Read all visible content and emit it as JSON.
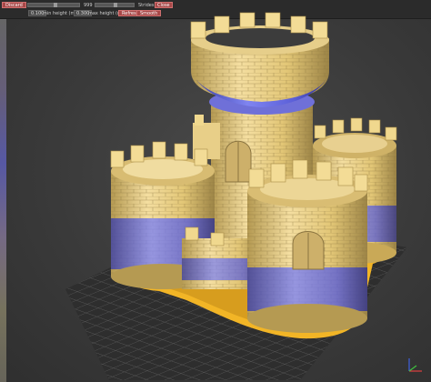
{
  "toolbar": {
    "discard_label": "Discard",
    "center_value": "999",
    "strides_label": "Strides",
    "close_label": "Close",
    "min_height_value": "0.100",
    "min_height_label": "min height (mm)",
    "max_height_value": "0.300",
    "max_height_label": "max height (mm)",
    "refresh_label": "Refresh",
    "smooth_label": "Smooth"
  },
  "colors": {
    "model_gold": "#e8c86a",
    "layer_blue": "#5b5fd8",
    "bed_grid": "#555555",
    "base_orange": "#f2b526"
  }
}
